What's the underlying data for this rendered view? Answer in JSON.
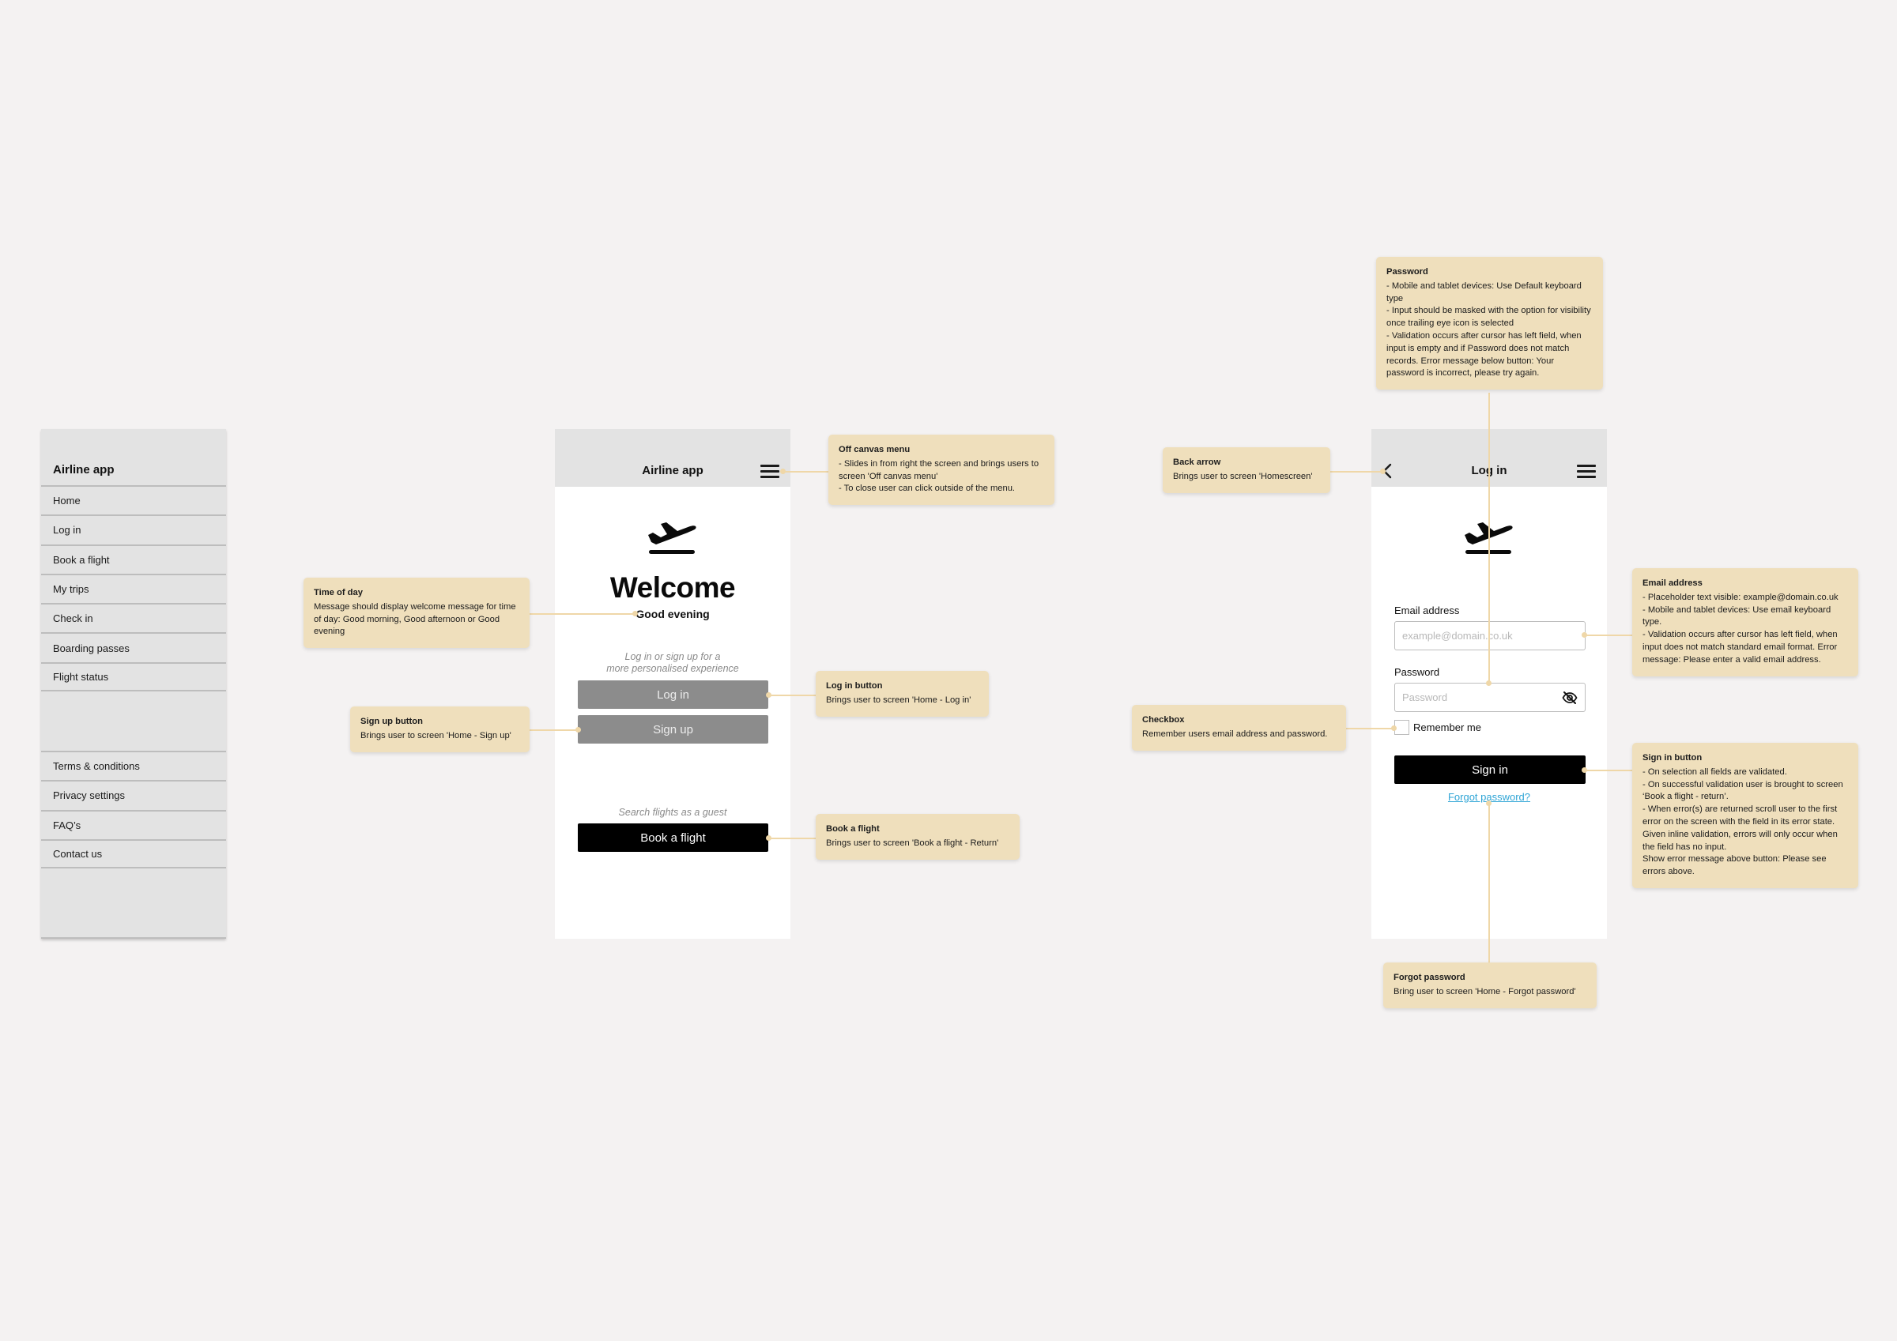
{
  "sidebar": {
    "title": "Airline app",
    "top_items": [
      {
        "label": "Home"
      },
      {
        "label": "Log in"
      },
      {
        "label": "Book a flight"
      },
      {
        "label": "My trips"
      },
      {
        "label": "Check in"
      },
      {
        "label": "Boarding passes"
      },
      {
        "label": "Flight status"
      }
    ],
    "bottom_items": [
      {
        "label": "Terms & conditions"
      },
      {
        "label": "Privacy settings"
      },
      {
        "label": "FAQ’s"
      },
      {
        "label": "Contact us"
      }
    ]
  },
  "home_screen": {
    "header_title": "Airline app",
    "menu_icon": "hamburger-icon",
    "logo_icon": "plane-departure-icon",
    "welcome": "Welcome",
    "greeting": "Good evening",
    "hint_line1": "Log in or sign up for a",
    "hint_line2": "more personalised experience",
    "login_button": "Log in",
    "signup_button": "Sign up",
    "guest_hint": "Search flights as a guest",
    "book_button": "Book a flight"
  },
  "login_screen": {
    "back_icon": "chevron-left-icon",
    "header_title": "Log in",
    "menu_icon": "hamburger-icon",
    "logo_icon": "plane-departure-icon",
    "email_label": "Email address",
    "email_placeholder": "example@domain.co.uk",
    "email_value": "",
    "password_label": "Password",
    "password_placeholder": "Password",
    "password_value": "",
    "eye_icon": "eye-off-icon",
    "remember_label": "Remember me",
    "remember_checked": false,
    "signin_button": "Sign in",
    "forgot_link": "Forgot password?"
  },
  "annotations": {
    "time_of_day": {
      "title": "Time of day",
      "body": "Message should display welcome message for time of day: Good morning, Good afternoon or Good evening"
    },
    "sign_up": {
      "title": "Sign up button",
      "body": "Brings user to screen 'Home - Sign up'"
    },
    "off_canvas": {
      "title": "Off canvas menu",
      "body": "- Slides in from right the screen and brings users to screen 'Off canvas menu'\n- To close user can click outside of the menu."
    },
    "log_in": {
      "title": "Log in button",
      "body": "Brings user to screen 'Home - Log in'"
    },
    "book_flight": {
      "title": "Book a flight",
      "body": "Brings user to screen 'Book a flight - Return'"
    },
    "back_arrow": {
      "title": "Back arrow",
      "body": "Brings user to screen 'Homescreen'"
    },
    "password": {
      "title": "Password",
      "body": "- Mobile and tablet devices: Use Default keyboard type\n- Input should be masked with the option for visibility once trailing eye icon is selected\n- Validation occurs after cursor has left field, when input is empty and if Password does not match records. Error message below button: Your password is incorrect, please try again."
    },
    "email": {
      "title": "Email address",
      "body": "- Placeholder text visible: example@domain.co.uk\n- Mobile and tablet devices: Use email keyboard type.\n- Validation occurs after cursor has left field, when input does not match standard email format. Error message: Please enter a valid email address."
    },
    "checkbox": {
      "title": "Checkbox",
      "body": "Remember users email address and password."
    },
    "sign_in": {
      "title": "Sign in button",
      "body": "- On selection all fields are validated.\n- On successful validation user is brought to screen ‘Book a flight - return’.\n- When error(s) are returned scroll user to the first error on the screen with the field in its error state. Given inline validation, errors will only occur when the field has no input.\nShow error message above button: Please see errors above."
    },
    "forgot": {
      "title": "Forgot password",
      "body": "Bring user to screen 'Home - Forgot password'"
    }
  },
  "colors": {
    "canvas": "#f4f2f2",
    "annotation": "#efdfbc",
    "connector": "#efd7a8",
    "header_grey": "#e3e3e3",
    "button_grey": "#8c8c8c",
    "button_black": "#000000",
    "link": "#2fa5d6"
  }
}
